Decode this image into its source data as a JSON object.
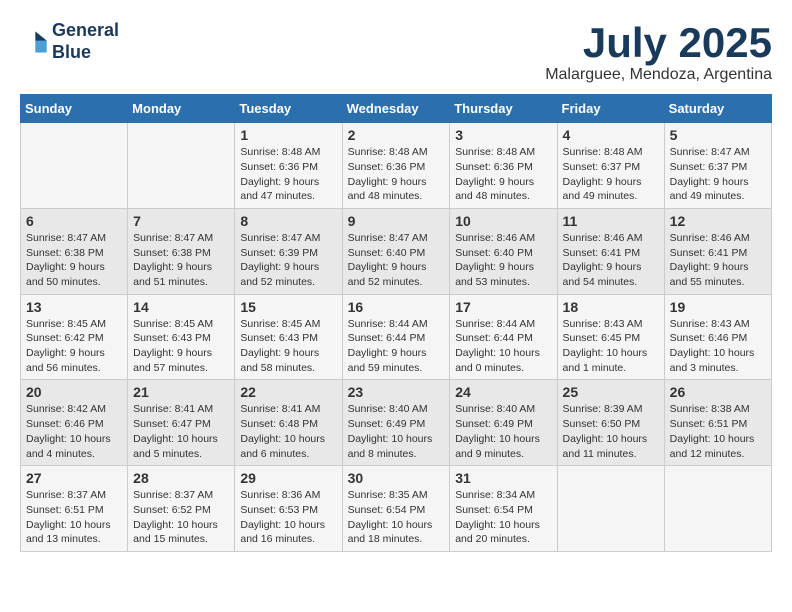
{
  "logo": {
    "line1": "General",
    "line2": "Blue"
  },
  "title": "July 2025",
  "subtitle": "Malarguee, Mendoza, Argentina",
  "days_of_week": [
    "Sunday",
    "Monday",
    "Tuesday",
    "Wednesday",
    "Thursday",
    "Friday",
    "Saturday"
  ],
  "weeks": [
    [
      {
        "day": "",
        "details": ""
      },
      {
        "day": "",
        "details": ""
      },
      {
        "day": "1",
        "details": "Sunrise: 8:48 AM\nSunset: 6:36 PM\nDaylight: 9 hours and 47 minutes."
      },
      {
        "day": "2",
        "details": "Sunrise: 8:48 AM\nSunset: 6:36 PM\nDaylight: 9 hours and 48 minutes."
      },
      {
        "day": "3",
        "details": "Sunrise: 8:48 AM\nSunset: 6:36 PM\nDaylight: 9 hours and 48 minutes."
      },
      {
        "day": "4",
        "details": "Sunrise: 8:48 AM\nSunset: 6:37 PM\nDaylight: 9 hours and 49 minutes."
      },
      {
        "day": "5",
        "details": "Sunrise: 8:47 AM\nSunset: 6:37 PM\nDaylight: 9 hours and 49 minutes."
      }
    ],
    [
      {
        "day": "6",
        "details": "Sunrise: 8:47 AM\nSunset: 6:38 PM\nDaylight: 9 hours and 50 minutes."
      },
      {
        "day": "7",
        "details": "Sunrise: 8:47 AM\nSunset: 6:38 PM\nDaylight: 9 hours and 51 minutes."
      },
      {
        "day": "8",
        "details": "Sunrise: 8:47 AM\nSunset: 6:39 PM\nDaylight: 9 hours and 52 minutes."
      },
      {
        "day": "9",
        "details": "Sunrise: 8:47 AM\nSunset: 6:40 PM\nDaylight: 9 hours and 52 minutes."
      },
      {
        "day": "10",
        "details": "Sunrise: 8:46 AM\nSunset: 6:40 PM\nDaylight: 9 hours and 53 minutes."
      },
      {
        "day": "11",
        "details": "Sunrise: 8:46 AM\nSunset: 6:41 PM\nDaylight: 9 hours and 54 minutes."
      },
      {
        "day": "12",
        "details": "Sunrise: 8:46 AM\nSunset: 6:41 PM\nDaylight: 9 hours and 55 minutes."
      }
    ],
    [
      {
        "day": "13",
        "details": "Sunrise: 8:45 AM\nSunset: 6:42 PM\nDaylight: 9 hours and 56 minutes."
      },
      {
        "day": "14",
        "details": "Sunrise: 8:45 AM\nSunset: 6:43 PM\nDaylight: 9 hours and 57 minutes."
      },
      {
        "day": "15",
        "details": "Sunrise: 8:45 AM\nSunset: 6:43 PM\nDaylight: 9 hours and 58 minutes."
      },
      {
        "day": "16",
        "details": "Sunrise: 8:44 AM\nSunset: 6:44 PM\nDaylight: 9 hours and 59 minutes."
      },
      {
        "day": "17",
        "details": "Sunrise: 8:44 AM\nSunset: 6:44 PM\nDaylight: 10 hours and 0 minutes."
      },
      {
        "day": "18",
        "details": "Sunrise: 8:43 AM\nSunset: 6:45 PM\nDaylight: 10 hours and 1 minute."
      },
      {
        "day": "19",
        "details": "Sunrise: 8:43 AM\nSunset: 6:46 PM\nDaylight: 10 hours and 3 minutes."
      }
    ],
    [
      {
        "day": "20",
        "details": "Sunrise: 8:42 AM\nSunset: 6:46 PM\nDaylight: 10 hours and 4 minutes."
      },
      {
        "day": "21",
        "details": "Sunrise: 8:41 AM\nSunset: 6:47 PM\nDaylight: 10 hours and 5 minutes."
      },
      {
        "day": "22",
        "details": "Sunrise: 8:41 AM\nSunset: 6:48 PM\nDaylight: 10 hours and 6 minutes."
      },
      {
        "day": "23",
        "details": "Sunrise: 8:40 AM\nSunset: 6:49 PM\nDaylight: 10 hours and 8 minutes."
      },
      {
        "day": "24",
        "details": "Sunrise: 8:40 AM\nSunset: 6:49 PM\nDaylight: 10 hours and 9 minutes."
      },
      {
        "day": "25",
        "details": "Sunrise: 8:39 AM\nSunset: 6:50 PM\nDaylight: 10 hours and 11 minutes."
      },
      {
        "day": "26",
        "details": "Sunrise: 8:38 AM\nSunset: 6:51 PM\nDaylight: 10 hours and 12 minutes."
      }
    ],
    [
      {
        "day": "27",
        "details": "Sunrise: 8:37 AM\nSunset: 6:51 PM\nDaylight: 10 hours and 13 minutes."
      },
      {
        "day": "28",
        "details": "Sunrise: 8:37 AM\nSunset: 6:52 PM\nDaylight: 10 hours and 15 minutes."
      },
      {
        "day": "29",
        "details": "Sunrise: 8:36 AM\nSunset: 6:53 PM\nDaylight: 10 hours and 16 minutes."
      },
      {
        "day": "30",
        "details": "Sunrise: 8:35 AM\nSunset: 6:54 PM\nDaylight: 10 hours and 18 minutes."
      },
      {
        "day": "31",
        "details": "Sunrise: 8:34 AM\nSunset: 6:54 PM\nDaylight: 10 hours and 20 minutes."
      },
      {
        "day": "",
        "details": ""
      },
      {
        "day": "",
        "details": ""
      }
    ]
  ]
}
